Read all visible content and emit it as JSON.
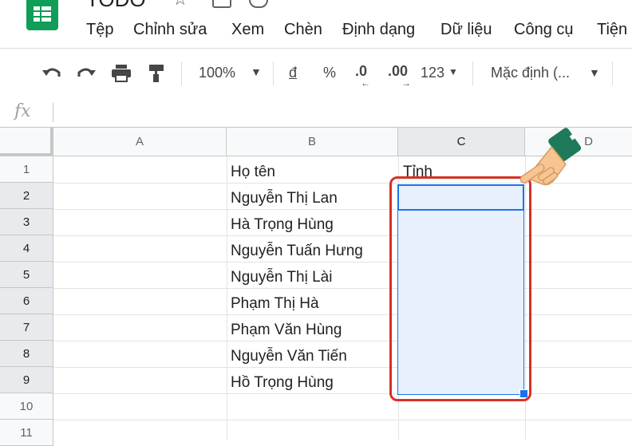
{
  "header": {
    "doc_title": "TODO",
    "menu": [
      "Tệp",
      "Chỉnh sửa",
      "Xem",
      "Chèn",
      "Định dạng",
      "Dữ liệu",
      "Công cụ",
      "Tiện"
    ]
  },
  "toolbar": {
    "zoom": "100%",
    "currency": "đ",
    "percent": "%",
    "decrease_decimal": ".0",
    "increase_decimal": ".00",
    "more_formats": "123",
    "font": "Mặc định (..."
  },
  "formula_bar": {
    "fx": "fx"
  },
  "grid": {
    "columns": [
      "A",
      "B",
      "C",
      "D"
    ],
    "rows": [
      "1",
      "2",
      "3",
      "4",
      "5",
      "6",
      "7",
      "8",
      "9",
      "10",
      "11"
    ],
    "column_b": [
      "Họ tên",
      "Nguyễn Thị Lan",
      "Hà Trọng Hùng",
      "Nguyễn Tuấn Hưng",
      "Nguyễn Thị Lài",
      "Phạm Thị Hà",
      "Phạm Văn Hùng",
      "Nguyễn Văn Tiến",
      "Hồ Trọng Hùng"
    ],
    "c1": "Tỉnh"
  },
  "colors": {
    "accent": "#1a73e8",
    "highlight": "#d93025",
    "sheets_green": "#0f9d58"
  }
}
